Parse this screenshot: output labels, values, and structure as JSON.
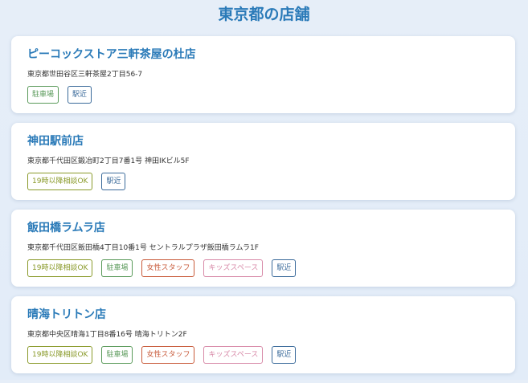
{
  "page": {
    "title": "東京都の店舗"
  },
  "stores": [
    {
      "name": "ピーコックストア三軒茶屋の杜店",
      "address": "東京都世田谷区三軒茶屋2丁目56-7",
      "tags": [
        "駐車場",
        "駅近"
      ]
    },
    {
      "name": "神田駅前店",
      "address": "東京都千代田区鍛冶町2丁目7番1号 神田IKビル5F",
      "tags": [
        "19時以降相談OK",
        "駅近"
      ]
    },
    {
      "name": "飯田橋ラムラ店",
      "address": "東京都千代田区飯田橋4丁目10番1号 セントラルプラザ飯田橋ラムラ1F",
      "tags": [
        "19時以降相談OK",
        "駐車場",
        "女性スタッフ",
        "キッズスペース",
        "駅近"
      ]
    },
    {
      "name": "晴海トリトン店",
      "address": "東京都中央区晴海1丁目8番16号 晴海トリトン2F",
      "tags": [
        "19時以降相談OK",
        "駐車場",
        "女性スタッフ",
        "キッズスペース",
        "駅近"
      ]
    }
  ],
  "tag_colors": {
    "19時以降相談OK": "#8a9a2a",
    "駐車場": "#5a9a5a",
    "女性スタッフ": "#c85a3a",
    "キッズスペース": "#d88aa8",
    "駅近": "#3a6a9a"
  }
}
